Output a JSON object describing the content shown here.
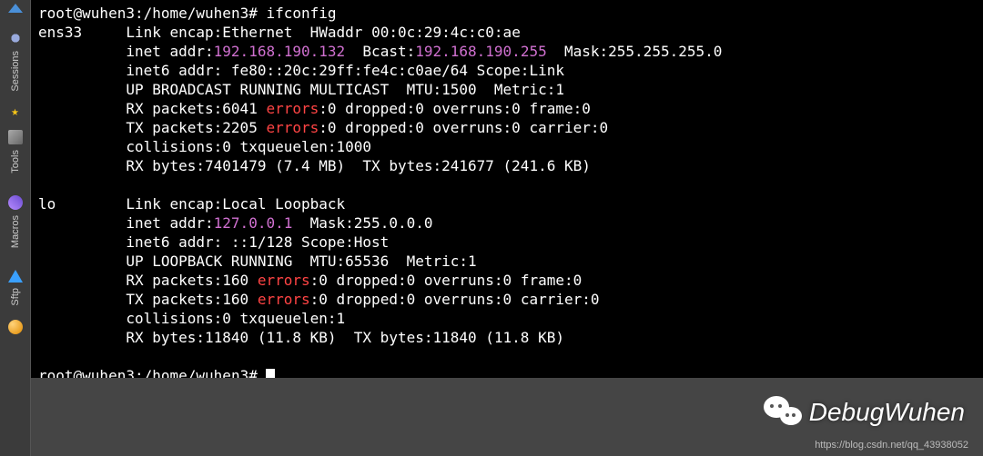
{
  "sidebar": {
    "tabs": [
      {
        "label": "Sessions"
      },
      {
        "label": "Tools"
      },
      {
        "label": "Macros"
      },
      {
        "label": "Sftp"
      }
    ]
  },
  "prompt1": {
    "user_host": "root@wuhen3",
    "sep": ":",
    "path": "/home/wuhen3",
    "hash": "#",
    "cmd": "ifconfig"
  },
  "ifaces": {
    "ens33": {
      "name": "ens33",
      "l1a": "Link encap:Ethernet  HWaddr ",
      "hwaddr": "00:0c:29:4c:c0:ae",
      "l2a": "inet addr:",
      "ip": "192.168.190.132",
      "l2b": "  Bcast:",
      "bcast": "192.168.190.255",
      "l2c": "  Mask:255.255.255.0",
      "l3": "inet6 addr: fe80::20c:29ff:fe4c:c0ae/64 Scope:Link",
      "l4": "UP BROADCAST RUNNING MULTICAST  MTU:1500  Metric:1",
      "l5a": "RX packets:6041 ",
      "err": "errors",
      "l5b": ":0 dropped:0 overruns:0 frame:0",
      "l6a": "TX packets:2205 ",
      "l6b": ":0 dropped:0 overruns:0 carrier:0",
      "l7": "collisions:0 txqueuelen:1000",
      "l8": "RX bytes:7401479 (7.4 MB)  TX bytes:241677 (241.6 KB)"
    },
    "lo": {
      "name": "lo",
      "l1": "Link encap:Local Loopback",
      "l2a": "inet addr:",
      "ip": "127.0.0.1",
      "l2b": "  Mask:255.0.0.0",
      "l3": "inet6 addr: ::1/128 Scope:Host",
      "l4": "UP LOOPBACK RUNNING  MTU:65536  Metric:1",
      "l5a": "RX packets:160 ",
      "err": "errors",
      "l5b": ":0 dropped:0 overruns:0 frame:0",
      "l6a": "TX packets:160 ",
      "l6b": ":0 dropped:0 overruns:0 carrier:0",
      "l7": "collisions:0 txqueuelen:1",
      "l8": "RX bytes:11840 (11.8 KB)  TX bytes:11840 (11.8 KB)"
    }
  },
  "prompt2": {
    "user_host": "root@wuhen3",
    "sep": ":",
    "path": "/home/wuhen3",
    "hash": "# "
  },
  "watermark": {
    "text": "DebugWuhen"
  },
  "csdn": {
    "url": "https://blog.csdn.net/qq_43938052"
  },
  "indent": "          "
}
